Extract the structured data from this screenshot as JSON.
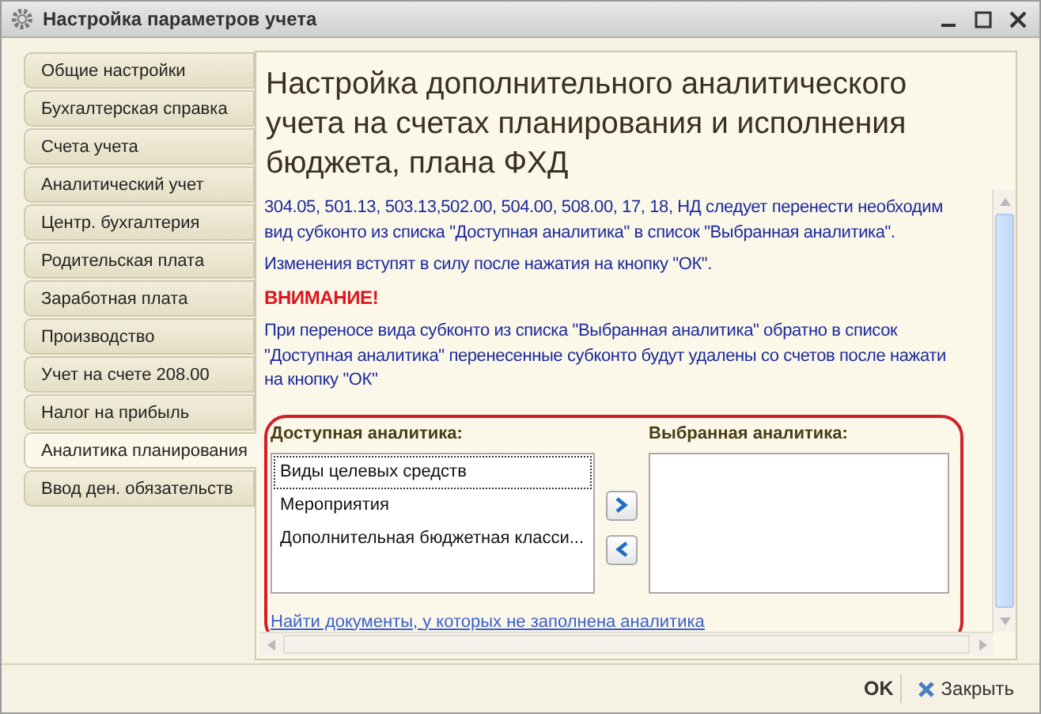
{
  "window": {
    "title": "Настройка параметров учета"
  },
  "tabs": [
    {
      "label": "Общие настройки",
      "selected": false
    },
    {
      "label": "Бухгалтерская справка",
      "selected": false
    },
    {
      "label": "Счета учета",
      "selected": false
    },
    {
      "label": "Аналитический учет",
      "selected": false
    },
    {
      "label": "Центр. бухгалтерия",
      "selected": false
    },
    {
      "label": "Родительская плата",
      "selected": false
    },
    {
      "label": "Заработная плата",
      "selected": false
    },
    {
      "label": "Производство",
      "selected": false
    },
    {
      "label": "Учет на счете 208.00",
      "selected": false
    },
    {
      "label": "Налог на прибыль",
      "selected": false
    },
    {
      "label": "Аналитика планирования",
      "selected": true
    },
    {
      "label": "Ввод ден. обязательств",
      "selected": false
    }
  ],
  "heading": "Настройка дополнительного аналитического учета на счетах планирования и исполнения бюджета, плана ФХД",
  "notes": [
    {
      "kind": "text",
      "lines": [
        "304.05, 501.13, 503.13,502.00, 504.00, 508.00, 17, 18, НД  следует перенести необходим",
        "вид субконто из списка \"Доступная аналитика\" в список \"Выбранная аналитика\"."
      ]
    },
    {
      "kind": "text",
      "lines": [
        "Изменения вступят в силу после нажатия на кнопку \"ОК\"."
      ]
    },
    {
      "kind": "warning",
      "lines": [
        "ВНИМАНИЕ!"
      ]
    },
    {
      "kind": "text",
      "lines": [
        "При переносе вида субконто из списка \"Выбранная аналитика\" обратно в список",
        "\"Доступная аналитика\" перенесенные субконто будут удалены со счетов после нажати",
        "на кнопку \"ОК\""
      ]
    }
  ],
  "available": {
    "label": "Доступная аналитика:",
    "items": [
      {
        "label": "Виды целевых средств",
        "selected": true
      },
      {
        "label": "Мероприятия",
        "selected": false
      },
      {
        "label": "Дополнительная бюджетная класси...",
        "selected": false
      }
    ]
  },
  "chosen": {
    "label": "Выбранная аналитика:"
  },
  "link": "Найти документы, у которых не заполнена аналитика",
  "footer": {
    "ok": "OK",
    "close": "Закрыть"
  }
}
